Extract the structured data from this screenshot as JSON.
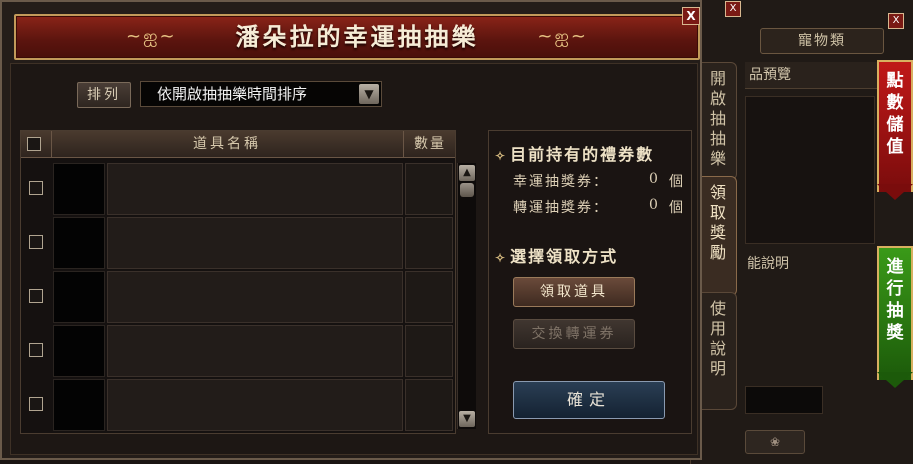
{
  "window": {
    "title": "潘朵拉的幸運抽抽樂",
    "close_label": "X",
    "title_ornament_left": "~ஐ~",
    "title_ornament_right": "~ஐ~"
  },
  "sort": {
    "button_label": "排列",
    "selected": "依開啟抽抽樂時間排序",
    "arrow": "▼"
  },
  "table": {
    "header_name": "道具名稱",
    "header_qty": "數量",
    "rows": [
      {
        "name": "",
        "qty": ""
      },
      {
        "name": "",
        "qty": ""
      },
      {
        "name": "",
        "qty": ""
      },
      {
        "name": "",
        "qty": ""
      },
      {
        "name": "",
        "qty": ""
      }
    ],
    "scroll_up": "▲",
    "scroll_down": "▼"
  },
  "coupons": {
    "title": "目前持有的禮券數",
    "lucky_label": "幸運抽獎券：",
    "lucky_count": "0",
    "transfer_label": "轉運抽獎券：",
    "transfer_count": "0",
    "unit": "個"
  },
  "claim_method": {
    "title": "選擇領取方式",
    "claim_item_label": "領取道具",
    "exchange_label": "交換轉運券",
    "confirm_label": "確定"
  },
  "side_tabs": {
    "open_draw": "開啟抽抽樂",
    "claim_reward": "領取獎勵",
    "instructions": "使用說明"
  },
  "background_window": {
    "close_label_1": "X",
    "close_label_2": "X",
    "tab_pets": "寵物類",
    "preview_label": "品預覽",
    "description_label": "能說明",
    "banner_points": "點數儲值",
    "banner_draw": "進行抽獎",
    "bottom_button": "❀"
  },
  "diamond": "✧",
  "colors": {
    "title_bar": "#7a1a12",
    "banner_red": "#b01414",
    "banner_green": "#2e8a14",
    "confirm_button": "#1e3246"
  }
}
